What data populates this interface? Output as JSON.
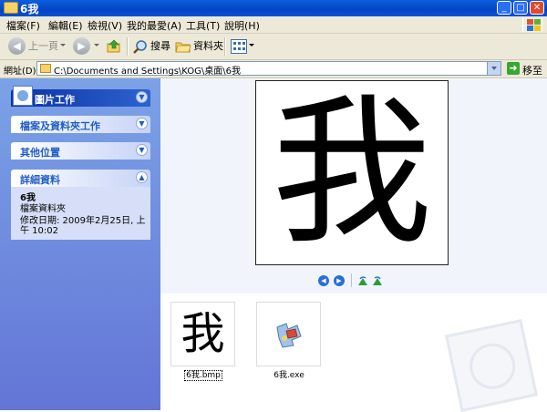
{
  "window": {
    "title": "6我",
    "minimize": "_",
    "maximize": "□",
    "close": "✕"
  },
  "menu": [
    "檔案(F)",
    "編輯(E)",
    "檢視(V)",
    "我的最愛(A)",
    "工具(T)",
    "說明(H)"
  ],
  "toolbar": {
    "back_label": "上一頁",
    "search_label": "搜尋",
    "folders_label": "資料夾"
  },
  "address": {
    "label": "網址(D)",
    "path": "C:\\Documents and Settings\\KOG\\桌面\\6我",
    "go_label": "移至"
  },
  "sidebar": {
    "panels": [
      {
        "title": "圖片工作",
        "state": "collapsed"
      },
      {
        "title": "檔案及資料夾工作",
        "state": "collapsed"
      },
      {
        "title": "其他位置",
        "state": "collapsed"
      },
      {
        "title": "詳細資料",
        "state": "expanded"
      }
    ],
    "details": {
      "name": "6我",
      "type": "檔案資料夾",
      "modified": "修改日期: 2009年2月25日, 上午 10:02"
    }
  },
  "preview": {
    "glyph": "我"
  },
  "files": [
    {
      "name": "6我.bmp",
      "thumb_glyph": "我",
      "selected": true
    },
    {
      "name": "6我.exe",
      "thumb_icon": "puzzle-app-icon",
      "selected": false
    }
  ],
  "colors": {
    "title_bar": "#0a5fde",
    "sidebar": "#7ba2e7",
    "panel_title": "#215dc6",
    "preview_bg": "#f1f5fb"
  }
}
